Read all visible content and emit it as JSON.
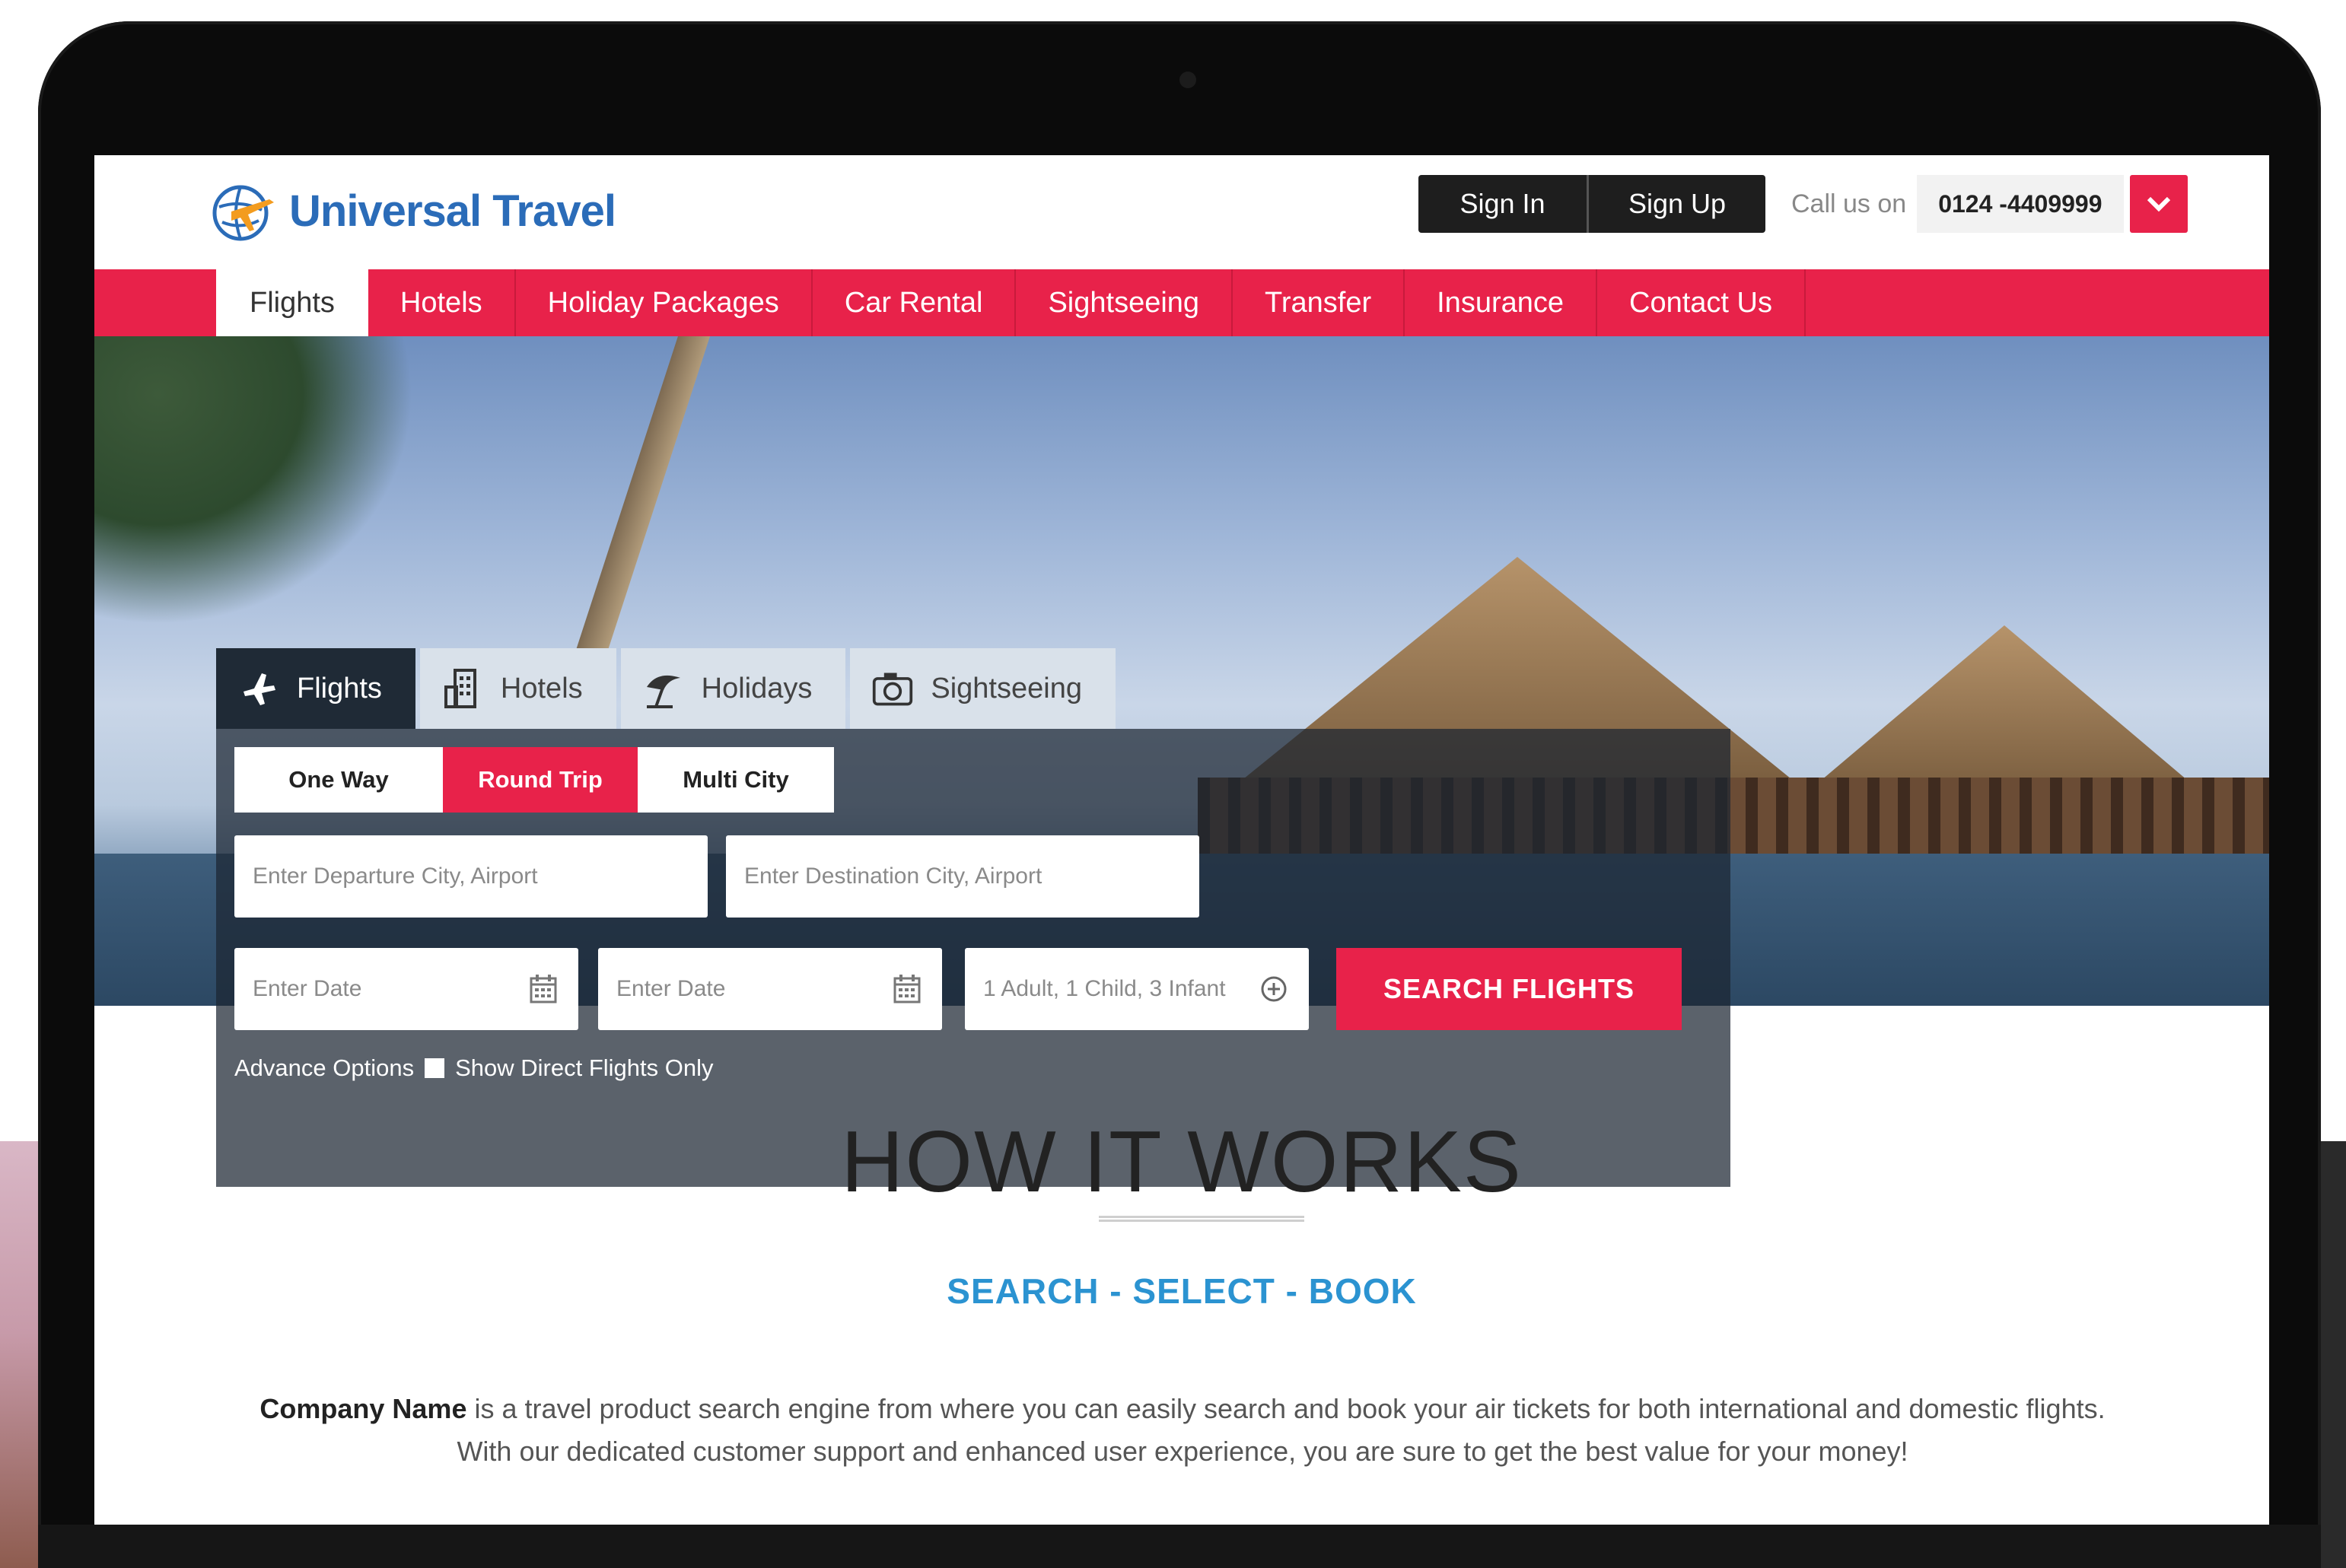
{
  "brand": {
    "name": "Universal Travel"
  },
  "auth": {
    "sign_in": "Sign In",
    "sign_up": "Sign Up"
  },
  "contact": {
    "label": "Call us on",
    "phone": "0124 -4409999"
  },
  "nav": {
    "items": [
      {
        "label": "Flights"
      },
      {
        "label": "Hotels"
      },
      {
        "label": "Holiday Packages"
      },
      {
        "label": "Car Rental"
      },
      {
        "label": "Sightseeing"
      },
      {
        "label": "Transfer"
      },
      {
        "label": "Insurance"
      },
      {
        "label": "Contact Us"
      }
    ],
    "active": "Flights"
  },
  "search": {
    "tabs": [
      {
        "label": "Flights",
        "icon": "plane-icon"
      },
      {
        "label": "Hotels",
        "icon": "building-icon"
      },
      {
        "label": "Holidays",
        "icon": "umbrella-icon"
      },
      {
        "label": "Sightseeing",
        "icon": "camera-icon"
      }
    ],
    "trip_types": [
      "One Way",
      "Round Trip",
      "Multi City"
    ],
    "selected_trip": "Round Trip",
    "departure_placeholder": "Enter Departure City, Airport",
    "destination_placeholder": "Enter Destination City, Airport",
    "depart_date_placeholder": "Enter Date",
    "return_date_placeholder": "Enter Date",
    "passengers": "1 Adult, 1 Child, 3 Infant",
    "search_button": "SEARCH FLIGHTS",
    "advance_options": "Advance Options",
    "direct_only": "Show Direct Flights Only"
  },
  "how": {
    "title": "HOW IT WORKS",
    "subtitle": "SEARCH - SELECT - BOOK",
    "company": "Company Name",
    "description": " is a travel product search engine from where you can easily search and book your air tickets for both international and domestic flights. With our dedicated customer support and enhanced user experience, you are sure to get the best value for your money!"
  },
  "colors": {
    "accent": "#e8224a",
    "brand": "#2b6cb8",
    "dark": "#1e1e1e",
    "link": "#2b93d1"
  }
}
